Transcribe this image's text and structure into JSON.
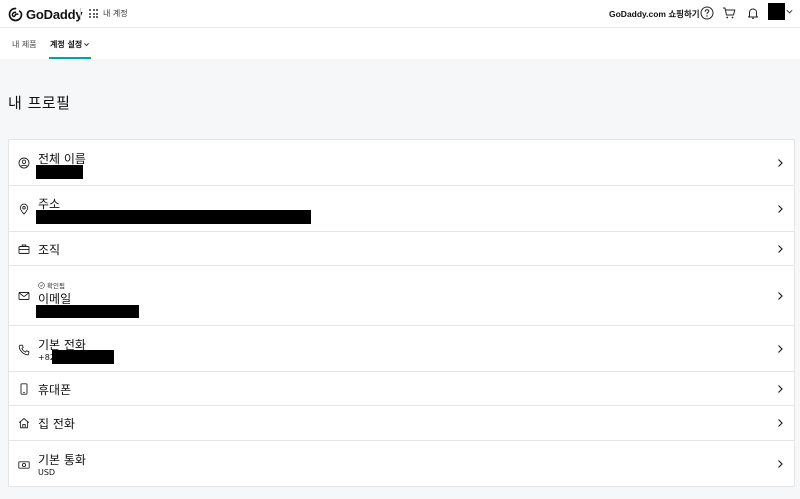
{
  "header": {
    "logo_text": "GoDaddy",
    "my_account": "내 계정",
    "shop_link": "GoDaddy.com 쇼핑하기",
    "icons": [
      "help-icon",
      "cart-icon",
      "bell-icon",
      "avatar"
    ]
  },
  "tabs": {
    "products": "내 제품",
    "settings": "계정 설정"
  },
  "page": {
    "title": "내 프로필"
  },
  "profile": {
    "full_name": {
      "label": "전체 이름",
      "icon": "user-circle-icon"
    },
    "address": {
      "label": "주소",
      "icon": "location-pin-icon"
    },
    "organization": {
      "label": "조직",
      "icon": "briefcase-icon"
    },
    "email": {
      "label": "이메일",
      "icon": "envelope-icon",
      "verified_label": "확인됨"
    },
    "primary_phone": {
      "label": "기본 전화",
      "icon": "phone-icon",
      "prefix": "+82"
    },
    "mobile": {
      "label": "휴대폰",
      "icon": "mobile-phone-icon"
    },
    "home_phone": {
      "label": "집 전화",
      "icon": "home-icon"
    },
    "currency": {
      "label": "기본 통화",
      "icon": "banknote-icon",
      "value": "USD"
    }
  },
  "colors": {
    "accent": "#00a4a6",
    "background": "#f5f7f8",
    "card": "#ffffff"
  }
}
